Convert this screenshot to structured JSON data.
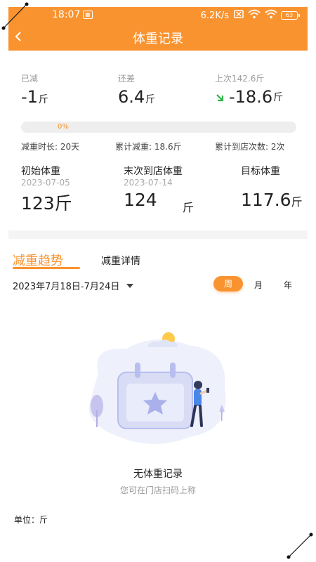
{
  "status_bar": {
    "time": "18:07",
    "net_speed": "6.2K/s",
    "battery": "63"
  },
  "header": {
    "title": "体重记录"
  },
  "summary": {
    "lost": {
      "label": "已减",
      "value": "-1",
      "unit": "斤"
    },
    "remaining": {
      "label": "还差",
      "value": "6.4",
      "unit": "斤"
    },
    "last_change": {
      "label": "上次142.6斤",
      "value": "-18.6",
      "unit": "斤"
    }
  },
  "progress": {
    "percent": 0,
    "text": "0%"
  },
  "meta": {
    "duration": "减重时长: 20天",
    "total_lost": "累计减重: 18.6斤",
    "visits": "累计到店次数: 2次"
  },
  "weights": {
    "initial": {
      "label": "初始体重",
      "date": "2023-07-05",
      "value": "123斤"
    },
    "latest": {
      "label": "末次到店体重",
      "date": "2023-07-14",
      "value": "124",
      "unit": "斤"
    },
    "target": {
      "label": "目标体重",
      "value": "117.6",
      "unit": "斤"
    }
  },
  "tabs": {
    "active": "减重趋势",
    "inactive": "减重详情"
  },
  "date_range": "2023年7月18日-7月24日",
  "periods": {
    "week": "周",
    "month": "月",
    "year": "年"
  },
  "empty_state": {
    "title": "无体重记录",
    "subtitle": "您可在门店扫码上称"
  },
  "unit_note": "单位：斤",
  "colors": {
    "accent": "#f9932f",
    "down_arrow": "#2fb34a",
    "muted_text": "#9a9a9a"
  }
}
